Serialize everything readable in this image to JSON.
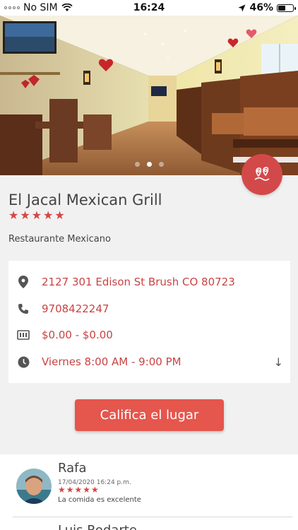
{
  "status_bar": {
    "carrier": "No SIM",
    "time": "16:24",
    "battery": "46%",
    "battery_level": 0.46
  },
  "gallery": {
    "photo": "restaurant interior photo",
    "page_count": 3,
    "active_page": 2
  },
  "map_button": {
    "icon": "map-pin-icon"
  },
  "restaurant": {
    "name": "El Jacal Mexican Grill",
    "rating": 5,
    "stars": "★★★★★",
    "category": "Restaurante Mexicano"
  },
  "info": {
    "address": "2127  301 Edison St  Brush  CO 80723",
    "phone": "9708422247",
    "price": "$0.00 - $0.00",
    "hours": "Viernes 8:00 AM - 9:00 PM",
    "hours_expand_icon": "↓"
  },
  "rate_button": {
    "label": "Califica el lugar"
  },
  "reviews": [
    {
      "name": "Rafa",
      "date": "17/04/2020 16:24 p.m.",
      "stars": "★★★★★",
      "rating": 5,
      "comment": "La comida es excelente"
    },
    {
      "name": "Luis Rodarte"
    }
  ],
  "colors": {
    "accent": "#d3494a",
    "button": "#e5564d",
    "link_text": "#c94343",
    "background": "#f1f1f1"
  }
}
